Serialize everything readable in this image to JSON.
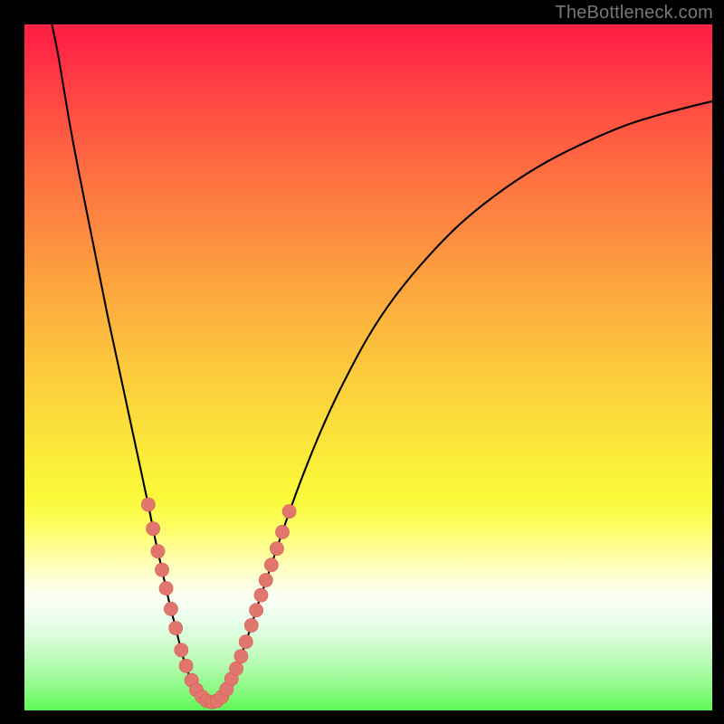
{
  "watermark": "TheBottleneck.com",
  "chart_data": {
    "type": "line",
    "title": "",
    "xlabel": "",
    "ylabel": "",
    "xlim": [
      0,
      100
    ],
    "ylim": [
      0,
      100
    ],
    "grid": false,
    "curve_points": [
      {
        "x": 4,
        "y": 100
      },
      {
        "x": 5,
        "y": 95
      },
      {
        "x": 6.5,
        "y": 86
      },
      {
        "x": 8,
        "y": 78
      },
      {
        "x": 10,
        "y": 68
      },
      {
        "x": 12,
        "y": 58
      },
      {
        "x": 13.5,
        "y": 51
      },
      {
        "x": 15,
        "y": 44
      },
      {
        "x": 16.5,
        "y": 37
      },
      {
        "x": 18,
        "y": 30
      },
      {
        "x": 19,
        "y": 25
      },
      {
        "x": 20,
        "y": 20.5
      },
      {
        "x": 21,
        "y": 16
      },
      {
        "x": 22,
        "y": 12
      },
      {
        "x": 23,
        "y": 8
      },
      {
        "x": 24,
        "y": 5
      },
      {
        "x": 25,
        "y": 3
      },
      {
        "x": 26,
        "y": 1.6
      },
      {
        "x": 27,
        "y": 1.2
      },
      {
        "x": 28,
        "y": 1.4
      },
      {
        "x": 29,
        "y": 2.4
      },
      {
        "x": 30,
        "y": 4.2
      },
      {
        "x": 31,
        "y": 6.6
      },
      {
        "x": 32,
        "y": 9.4
      },
      {
        "x": 33,
        "y": 12.4
      },
      {
        "x": 34,
        "y": 15.6
      },
      {
        "x": 35.5,
        "y": 20
      },
      {
        "x": 37.5,
        "y": 26
      },
      {
        "x": 40,
        "y": 33
      },
      {
        "x": 43,
        "y": 40.5
      },
      {
        "x": 46,
        "y": 47
      },
      {
        "x": 50,
        "y": 54.5
      },
      {
        "x": 54,
        "y": 60.5
      },
      {
        "x": 59,
        "y": 66.5
      },
      {
        "x": 64,
        "y": 71.5
      },
      {
        "x": 70,
        "y": 76.2
      },
      {
        "x": 76,
        "y": 80
      },
      {
        "x": 82,
        "y": 83
      },
      {
        "x": 88,
        "y": 85.5
      },
      {
        "x": 94,
        "y": 87.3
      },
      {
        "x": 100,
        "y": 88.8
      }
    ],
    "beads": [
      {
        "x": 18.0,
        "y": 30.0
      },
      {
        "x": 18.7,
        "y": 26.5
      },
      {
        "x": 19.4,
        "y": 23.2
      },
      {
        "x": 20.0,
        "y": 20.5
      },
      {
        "x": 20.6,
        "y": 17.8
      },
      {
        "x": 21.3,
        "y": 14.8
      },
      {
        "x": 22.0,
        "y": 12.0
      },
      {
        "x": 22.8,
        "y": 8.8
      },
      {
        "x": 23.5,
        "y": 6.5
      },
      {
        "x": 24.3,
        "y": 4.4
      },
      {
        "x": 25.0,
        "y": 3.0
      },
      {
        "x": 25.8,
        "y": 2.0
      },
      {
        "x": 26.5,
        "y": 1.4
      },
      {
        "x": 27.3,
        "y": 1.2
      },
      {
        "x": 28.0,
        "y": 1.4
      },
      {
        "x": 28.7,
        "y": 2.0
      },
      {
        "x": 29.4,
        "y": 3.1
      },
      {
        "x": 30.1,
        "y": 4.6
      },
      {
        "x": 30.8,
        "y": 6.1
      },
      {
        "x": 31.5,
        "y": 7.9
      },
      {
        "x": 32.2,
        "y": 10.0
      },
      {
        "x": 33.0,
        "y": 12.4
      },
      {
        "x": 33.7,
        "y": 14.6
      },
      {
        "x": 34.4,
        "y": 16.8
      },
      {
        "x": 35.1,
        "y": 19.0
      },
      {
        "x": 35.9,
        "y": 21.2
      },
      {
        "x": 36.7,
        "y": 23.6
      },
      {
        "x": 37.5,
        "y": 26.0
      },
      {
        "x": 38.5,
        "y": 29.0
      }
    ],
    "bead_radius": 1.0,
    "gradient_stops": [
      {
        "pos": 0.0,
        "color": "#fe2244"
      },
      {
        "pos": 0.3,
        "color": "#fd8a40"
      },
      {
        "pos": 0.67,
        "color": "#fbf33a"
      },
      {
        "pos": 0.81,
        "color": "#fefed0"
      },
      {
        "pos": 1.0,
        "color": "#5df851"
      }
    ]
  }
}
